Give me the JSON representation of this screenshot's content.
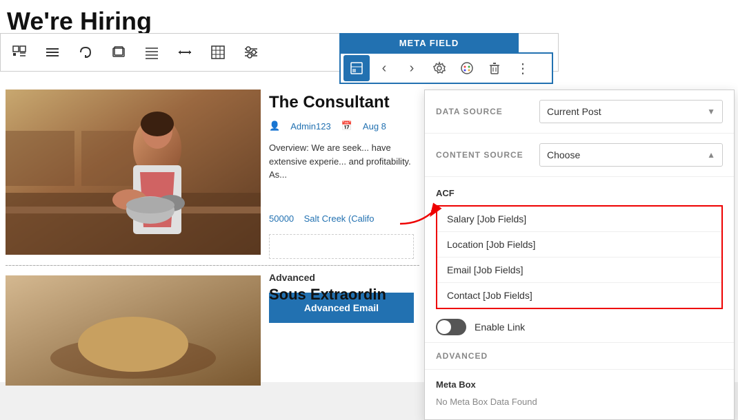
{
  "heading": "We're Hiring",
  "toolbar": {
    "buttons": [
      {
        "id": "grid-icon",
        "symbol": "⊞",
        "active": false
      },
      {
        "id": "list-icon",
        "symbol": "≡",
        "active": false
      },
      {
        "id": "loop-icon",
        "symbol": "∞",
        "active": false
      },
      {
        "id": "layers-icon",
        "symbol": "⧉",
        "active": false
      },
      {
        "id": "align-icon",
        "symbol": "☰",
        "active": false
      },
      {
        "id": "resize-icon",
        "symbol": "↔",
        "active": false
      },
      {
        "id": "table-icon",
        "symbol": "⊞",
        "active": false
      },
      {
        "id": "sliders-icon",
        "symbol": "⊟",
        "active": false
      }
    ],
    "meta_label": "META FIELD",
    "meta_buttons": [
      {
        "id": "meta-widget-icon",
        "symbol": "⊡",
        "active": true
      },
      {
        "id": "meta-left-icon",
        "symbol": "‹",
        "active": false
      },
      {
        "id": "meta-right-icon",
        "symbol": "›",
        "active": false
      },
      {
        "id": "meta-gear-icon",
        "symbol": "⚙",
        "active": false
      },
      {
        "id": "meta-palette-icon",
        "symbol": "🎨",
        "active": false
      },
      {
        "id": "meta-trash-icon",
        "symbol": "🗑",
        "active": false
      },
      {
        "id": "meta-more-icon",
        "symbol": "⋮",
        "active": false
      }
    ]
  },
  "post1": {
    "title": "The Consultant",
    "author": "Admin123",
    "date": "Aug 8",
    "excerpt": "Overview: We are seek... have extensive experie... and profitability. As...",
    "location_number": "50000",
    "location_city": "Salt Creek (Califo",
    "read_more": "",
    "advanced": "Advanced",
    "advanced_email": "Advanced Email"
  },
  "post2": {
    "title": "Sous Extraordin"
  },
  "panel": {
    "data_source_label": "DATA SOURCE",
    "data_source_value": "Current Post",
    "content_source_label": "CONTENT SOURCE",
    "content_source_value": "Choose",
    "acf_title": "ACF",
    "acf_options": [
      "Salary [Job Fields]",
      "Location [Job Fields]",
      "Email [Job Fields]",
      "Contact [Job Fields]"
    ],
    "enable_link_label": "Enable Link",
    "advanced_label": "Advanced",
    "metabox_title": "Meta Box",
    "metabox_empty": "No Meta Box Data Found"
  }
}
